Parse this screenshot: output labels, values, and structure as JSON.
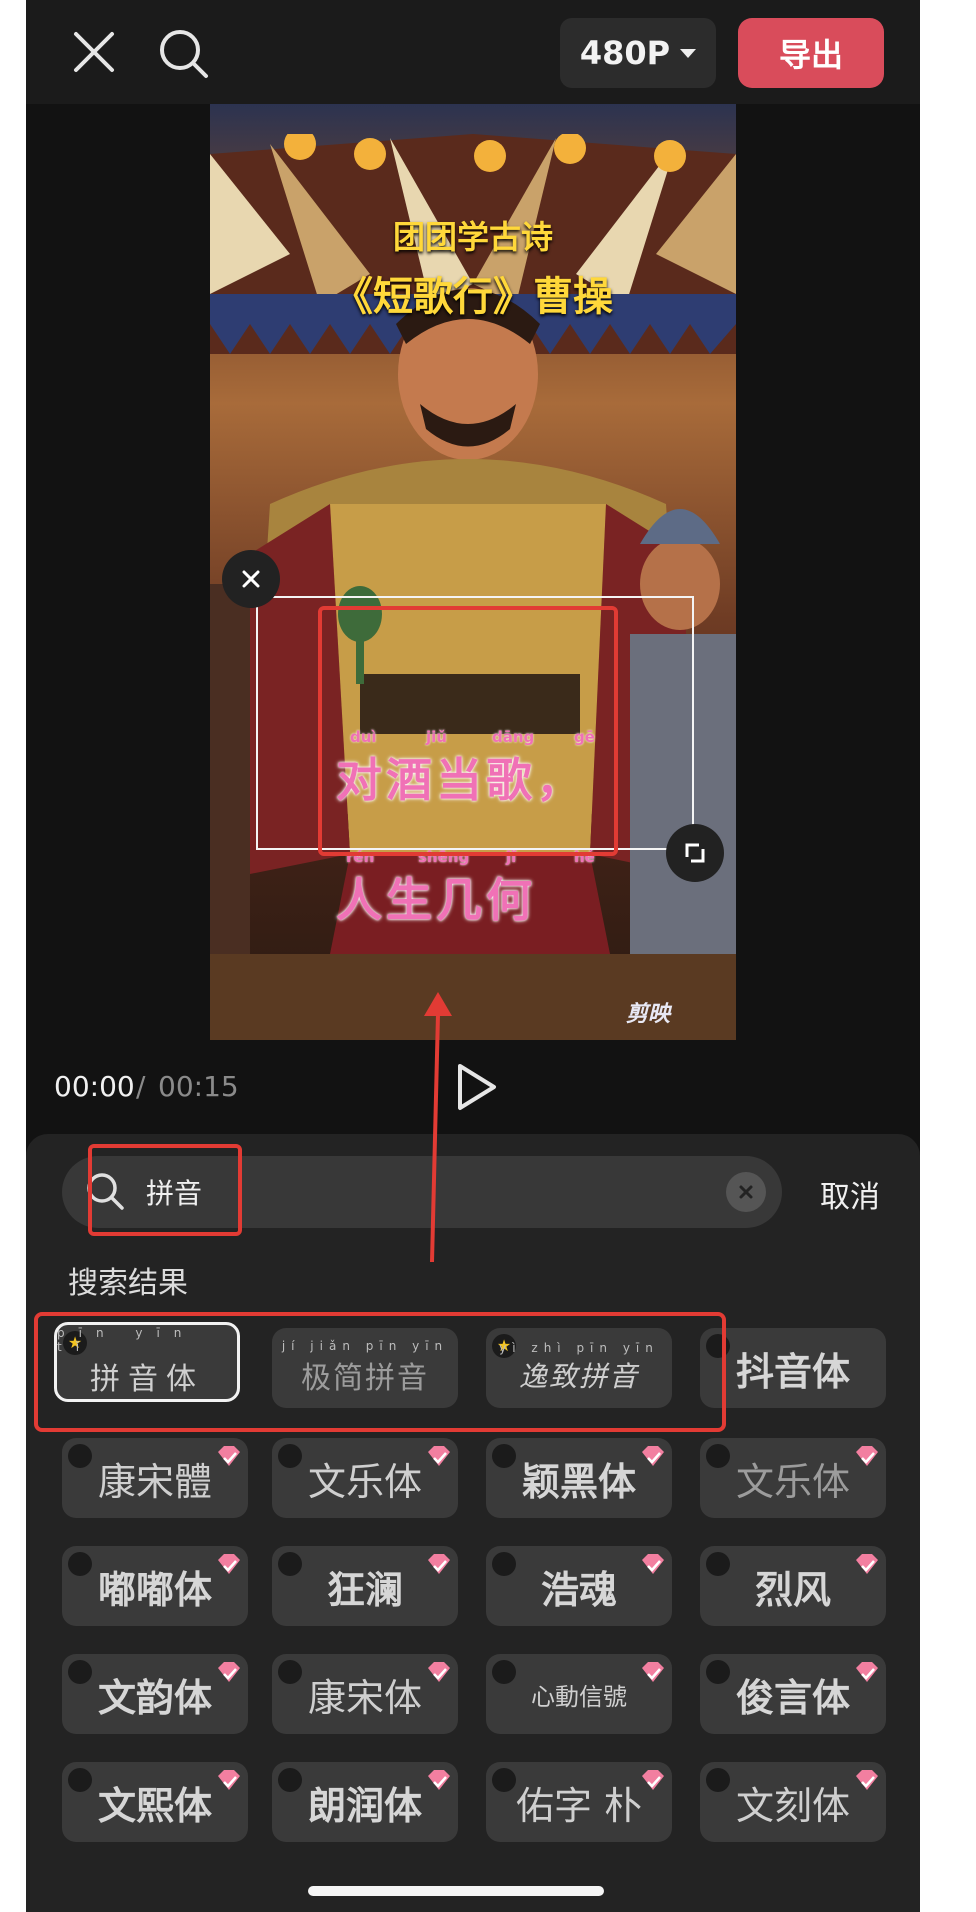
{
  "topbar": {
    "resolution_label": "480P",
    "export_label": "导出"
  },
  "video": {
    "title_line1": "团团学古诗",
    "title_line2": "《短歌行》曹操",
    "caption_line1": "对酒当歌，",
    "caption_line2": "人生几何",
    "pinyin_line1": [
      "duì",
      "jiǔ",
      "dāng",
      "gē"
    ],
    "pinyin_line2": [
      "rén",
      "shēng",
      "jǐ",
      "hé"
    ],
    "watermark": "剪映"
  },
  "playback": {
    "current_time": "00:00",
    "separator": "/",
    "total_time": "00:15"
  },
  "search": {
    "query": "拼音",
    "cancel_label": "取消",
    "results_label": "搜索结果"
  },
  "fonts": [
    {
      "label": "拼音体",
      "pinyin": "pīn yīn tǐ",
      "badge": "star",
      "premium": false,
      "selected": true
    },
    {
      "label": "极简拼音",
      "pinyin": "jí jiǎn pīn yīn",
      "badge": "none",
      "premium": false,
      "selected": false
    },
    {
      "label": "逸致拼音",
      "pinyin": "yì zhì pīn yīn",
      "badge": "star",
      "premium": false,
      "selected": false
    },
    {
      "label": "抖音体",
      "badge": "download",
      "premium": false
    },
    {
      "label": "康宋體",
      "badge": "download",
      "premium": true
    },
    {
      "label": "文乐体",
      "badge": "download",
      "premium": true
    },
    {
      "label": "颖黑体",
      "badge": "download",
      "premium": true
    },
    {
      "label": "文乐体",
      "badge": "download",
      "premium": true
    },
    {
      "label": "嘟嘟体",
      "badge": "download",
      "premium": true
    },
    {
      "label": "狂澜",
      "badge": "download",
      "premium": true
    },
    {
      "label": "浩魂",
      "badge": "download",
      "premium": true
    },
    {
      "label": "烈风",
      "badge": "download",
      "premium": true
    },
    {
      "label": "文韵体",
      "badge": "download",
      "premium": true
    },
    {
      "label": "康宋体",
      "badge": "download",
      "premium": true
    },
    {
      "label": "心動信號",
      "badge": "download",
      "premium": true
    },
    {
      "label": "俊言体",
      "badge": "download",
      "premium": true
    },
    {
      "label": "文熙体",
      "badge": "download",
      "premium": true
    },
    {
      "label": "朗润体",
      "badge": "download",
      "premium": true
    },
    {
      "label": "佑字 朴",
      "badge": "download",
      "premium": true
    },
    {
      "label": "文刻体",
      "badge": "download",
      "premium": true
    }
  ],
  "colors": {
    "accent_red": "#d94c5b",
    "annotation_red": "#e23b34",
    "caption_pink": "#f071b6",
    "title_yellow": "#ffd83a"
  }
}
